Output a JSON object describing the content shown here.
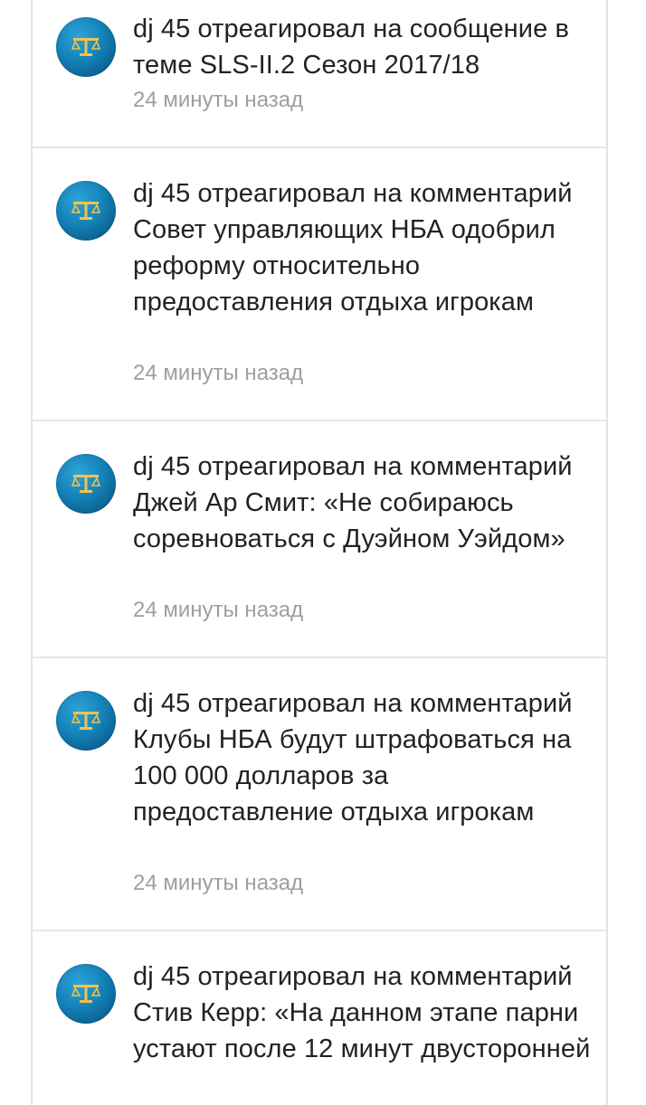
{
  "notifications": [
    {
      "text": "dj 45 отреагировал на сообщение в теме SLS-II.2 Сезон 2017/18",
      "time": "24 минуты назад"
    },
    {
      "text": "dj 45 отреагировал на комментарий Совет управляющих НБА одобрил реформу относительно предоставления отдыха игрокам",
      "time": "24 минуты назад"
    },
    {
      "text": "dj 45 отреагировал на комментарий Джей Ар Смит: «Не собираюсь соревноваться с Дуэйном Уэйдом»",
      "time": "24 минуты назад"
    },
    {
      "text": "dj 45 отреагировал на комментарий Клубы НБА будут штрафоваться на 100 000 долларов за предоставление отдыха игрокам",
      "time": "24 минуты назад"
    },
    {
      "text": "dj 45 отреагировал на комментарий Стив Керр: «На данном этапе парни устают после 12 минут двусторонней",
      "time": ""
    }
  ],
  "colors": {
    "avatar": "#1482b9",
    "avatar_glyph": "#f2c24a",
    "timestamp": "#9e9e9e",
    "divider": "#e6e6e6"
  },
  "icons": {
    "avatar": "scales-icon"
  }
}
